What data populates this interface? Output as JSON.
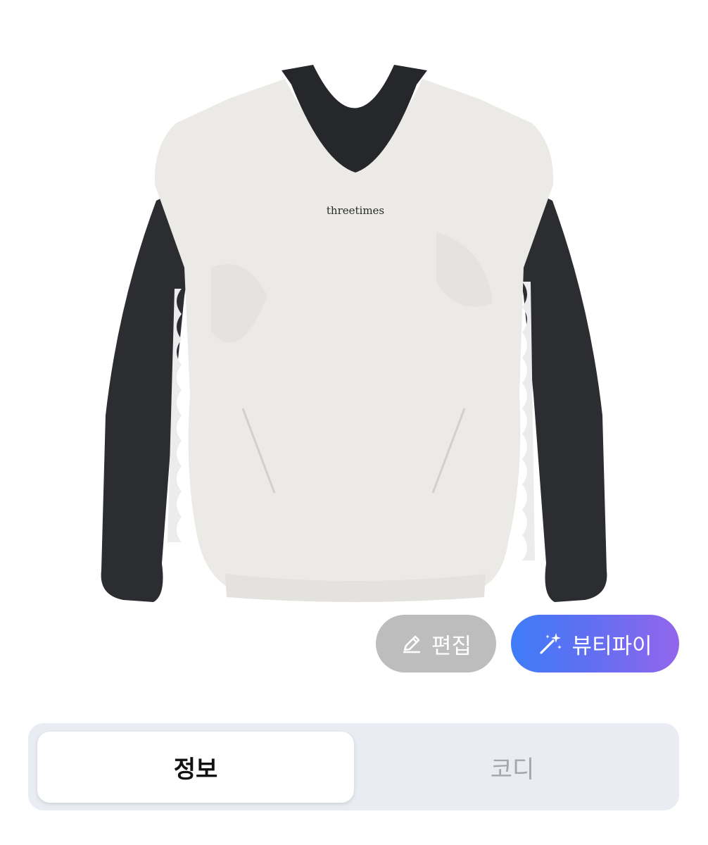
{
  "product": {
    "image_alt": "threetimes pullover",
    "brand_print": "threetimes"
  },
  "actions": {
    "edit_label": "편집",
    "beautify_label": "뷰티파이",
    "edit_icon": "pencil-icon",
    "beautify_icon": "magic-wand-sparkle-icon"
  },
  "tabs": [
    {
      "label": "정보",
      "selected": true
    },
    {
      "label": "코디",
      "selected": false
    }
  ],
  "colors": {
    "edit_button_bg": "#bdbdbd",
    "beautify_gradient_start": "#3f7cf7",
    "beautify_gradient_end": "#9266ec",
    "segment_bg": "#eaecf4",
    "selected_tab_text": "#111111",
    "unselected_tab_text": "#a3a6ad"
  }
}
